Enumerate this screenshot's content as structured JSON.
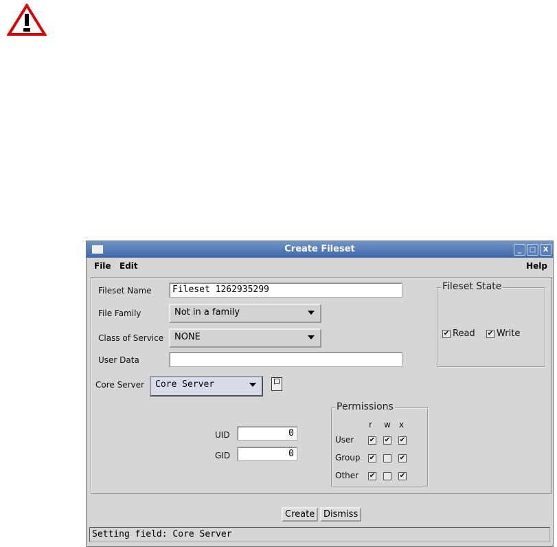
{
  "window": {
    "title": "Create Fileset",
    "controls": [
      "_",
      "□",
      "X"
    ]
  },
  "menu": {
    "file": "File",
    "edit": "Edit",
    "help": "Help"
  },
  "form": {
    "fileset_name_label": "Fileset Name",
    "fileset_name_value": "Fileset 1262935299",
    "file_family_label": "File Family",
    "file_family_value": "Not in a family",
    "cos_label": "Class of Service",
    "cos_value": "NONE",
    "user_data_label": "User Data",
    "user_data_value": "",
    "core_server_label": "Core Server",
    "core_server_value": "Core Server",
    "uid_label": "UID",
    "uid_value": "0",
    "gid_label": "GID",
    "gid_value": "0"
  },
  "fileset_state": {
    "title": "Fileset State",
    "read_label": "Read",
    "read_checked": true,
    "write_label": "Write",
    "write_checked": true
  },
  "permissions": {
    "title": "Permissions",
    "cols": [
      "r",
      "w",
      "x"
    ],
    "rows": [
      {
        "label": "User",
        "values": [
          true,
          true,
          true
        ]
      },
      {
        "label": "Group",
        "values": [
          true,
          false,
          true
        ]
      },
      {
        "label": "Other",
        "values": [
          true,
          false,
          true
        ]
      }
    ]
  },
  "buttons": {
    "create": "Create",
    "dismiss": "Dismiss"
  },
  "status": "Setting field: Core Server"
}
